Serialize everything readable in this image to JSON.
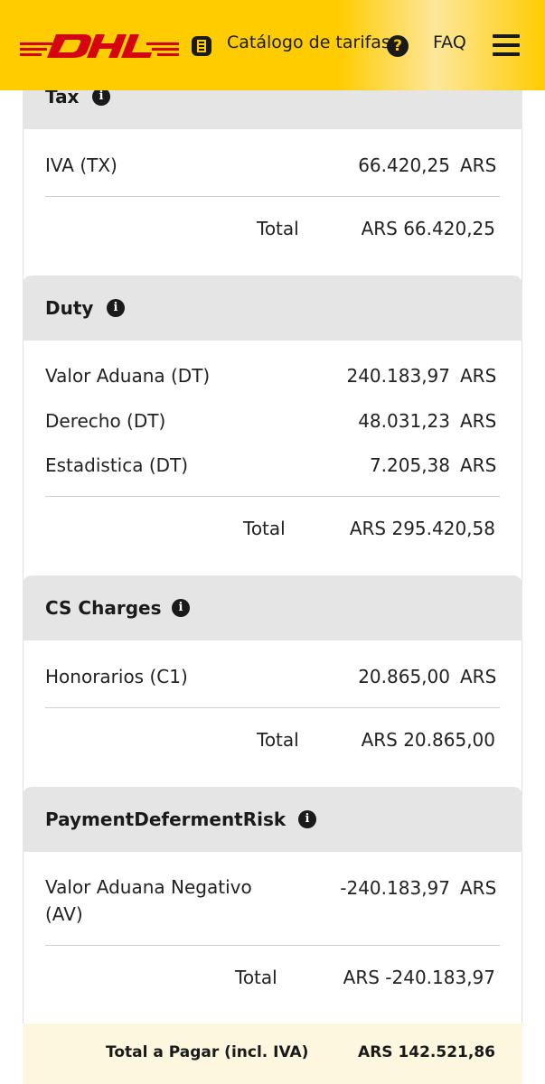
{
  "header": {
    "catalog_label": "Catálogo de tarifas",
    "help_symbol": "?",
    "faq_label": "FAQ",
    "brand_color": "#ffcc00",
    "logo_color": "#d40511"
  },
  "sections": {
    "tax": {
      "title": "Tax",
      "rows": [
        {
          "label": "IVA (TX)",
          "amount": "66.420,25",
          "currency": "ARS"
        }
      ],
      "total_label": "Total",
      "total_value": "ARS 66.420,25"
    },
    "duty": {
      "title": "Duty",
      "rows": [
        {
          "label": "Valor Aduana (DT)",
          "amount": "240.183,97",
          "currency": "ARS"
        },
        {
          "label": "Derecho (DT)",
          "amount": "48.031,23",
          "currency": "ARS"
        },
        {
          "label": "Estadistica (DT)",
          "amount": "7.205,38",
          "currency": "ARS"
        }
      ],
      "total_label": "Total",
      "total_value": "ARS 295.420,58"
    },
    "cs": {
      "title": "CS Charges",
      "rows": [
        {
          "label": "Honorarios (C1)",
          "amount": "20.865,00",
          "currency": "ARS"
        }
      ],
      "total_label": "Total",
      "total_value": "ARS 20.865,00"
    },
    "pdr": {
      "title": "PaymentDefermentRisk",
      "rows": [
        {
          "label": "Valor Aduana Negativo (AV)",
          "amount": "-240.183,97",
          "currency": "ARS"
        }
      ],
      "total_label": "Total",
      "total_value": "ARS -240.183,97"
    }
  },
  "info_symbol": "i",
  "grand_total": {
    "label": "Total a Pagar (incl. IVA)",
    "value": "ARS 142.521,86"
  }
}
